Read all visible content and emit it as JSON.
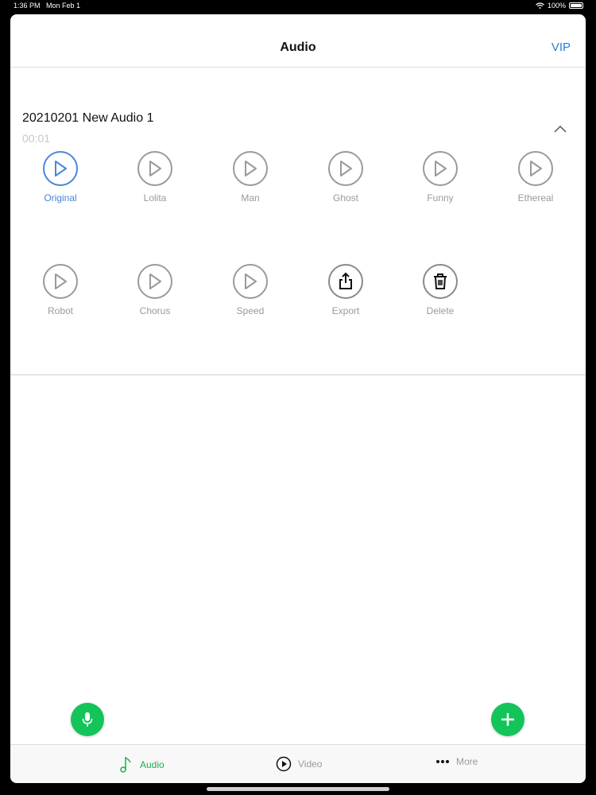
{
  "status_bar": {
    "time": "1:36 PM",
    "date": "Mon Feb 1",
    "battery": "100%"
  },
  "nav": {
    "title": "Audio",
    "vip_label": "VIP"
  },
  "recording": {
    "title": "20210201 New Audio 1",
    "duration": "00:01",
    "effects_row1": [
      {
        "label": "Original",
        "icon": "play-icon"
      },
      {
        "label": "Lolita",
        "icon": "play-icon"
      },
      {
        "label": "Man",
        "icon": "play-icon"
      },
      {
        "label": "Ghost",
        "icon": "play-icon"
      },
      {
        "label": "Funny",
        "icon": "play-icon"
      },
      {
        "label": "Ethereal",
        "icon": "play-icon"
      }
    ],
    "effects_row2": [
      {
        "label": "Robot",
        "icon": "play-icon"
      },
      {
        "label": "Chorus",
        "icon": "play-icon"
      },
      {
        "label": "Speed",
        "icon": "play-icon"
      },
      {
        "label": "Export",
        "icon": "share-icon"
      },
      {
        "label": "Delete",
        "icon": "trash-icon"
      }
    ],
    "selected_effect": "Original"
  },
  "tabbar": {
    "tabs": [
      {
        "label": "Audio",
        "icon": "music-note-icon",
        "active": true
      },
      {
        "label": "Video",
        "icon": "play-circle-icon",
        "active": false
      },
      {
        "label": "More",
        "icon": "more-dots-icon",
        "active": false
      }
    ]
  },
  "colors": {
    "accent_blue": "#4a86d8",
    "vip_blue": "#2a7fd4",
    "green": "#13c45b",
    "muted": "#9a9a9a"
  }
}
